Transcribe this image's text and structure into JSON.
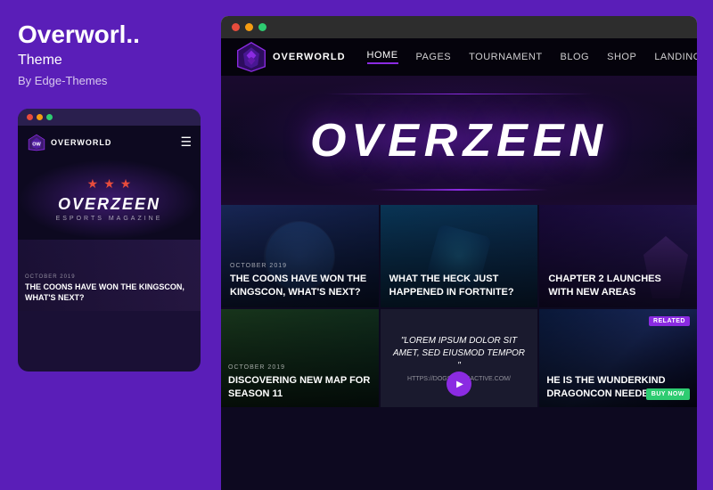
{
  "sidebar": {
    "title": "Overworl..",
    "subtitle": "Theme",
    "author": "By Edge-Themes",
    "dots": [
      "red",
      "yellow",
      "green"
    ],
    "mobile_preview": {
      "logo": "OVERWORLD",
      "stars": [
        "★",
        "★",
        "★"
      ],
      "hero_title": "OVERZEEN",
      "hero_tagline": "ESPORTS MAGAZINE",
      "article_tag": "OCTOBER 2019",
      "article_title": "THE COONS HAVE WON THE KINGSCON, WHAT'S NEXT?"
    }
  },
  "browser": {
    "dots": [
      "red",
      "yellow",
      "green"
    ],
    "nav": {
      "logo": "OVERWORLD",
      "links": [
        {
          "label": "HOME",
          "active": true
        },
        {
          "label": "PAGES",
          "active": false
        },
        {
          "label": "TOURNAMENT",
          "active": false
        },
        {
          "label": "BLOG",
          "active": false
        },
        {
          "label": "SHOP",
          "active": false
        },
        {
          "label": "LANDING",
          "active": false
        }
      ]
    },
    "hero": {
      "title": "OVERZEEN"
    },
    "articles_row1": [
      {
        "tag": "OCTOBER 2019",
        "title": "THE COONS HAVE WON THE KINGSCON, WHAT'S NEXT?",
        "card_class": "card-1"
      },
      {
        "tag": "",
        "title": "WHAT THE HECK JUST HAPPENED IN FORTNITE?",
        "card_class": "card-2"
      },
      {
        "tag": "",
        "title": "CHAPTER 2 LAUNCHES WITH NEW AREAS",
        "card_class": "card-3"
      }
    ],
    "articles_row2": [
      {
        "tag": "OCTOBER 2019",
        "title": "DISCOVERING NEW MAP FOR SEASON 11",
        "card_class": "card-4"
      },
      {
        "quote": true,
        "quote_text": "\"LOREM IPSUM DOLOR SIT AMET, SED EIUSMOD TEMPOR \"",
        "quote_url": "HTTPS://DOGSINTERACTIVE.COM/",
        "card_class": "card-5"
      },
      {
        "tag": "",
        "title": "HE IS THE WUNDERKIND DRAGONCON NEEDED",
        "card_class": "card-6"
      }
    ],
    "badges": {
      "related": "RELATED",
      "buy_now": "BUY NOW"
    }
  }
}
